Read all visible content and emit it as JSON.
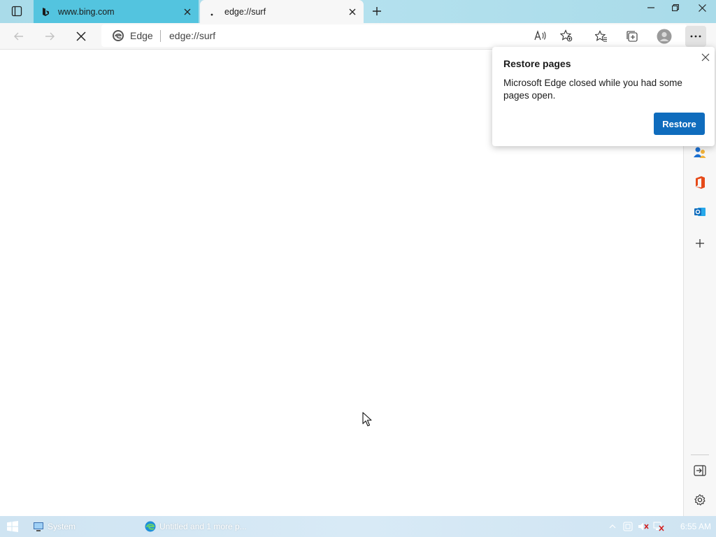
{
  "window": {
    "controls": {
      "minimize_icon": "minimize-icon",
      "restore_icon": "restore-icon",
      "close_icon": "close-icon"
    }
  },
  "tabs": [
    {
      "title": "www.bing.com",
      "icon": "bing-favicon",
      "active": false
    },
    {
      "title": "edge://surf",
      "icon": "loading-dot",
      "active": true
    }
  ],
  "toolbar": {
    "site_label": "Edge",
    "url": "edge://surf",
    "buttons": [
      "back",
      "forward",
      "stop",
      "read-aloud",
      "add-favorite",
      "favorites",
      "collections",
      "profile",
      "more"
    ]
  },
  "sidebar": {
    "items": [
      "people-icon",
      "office-icon",
      "outlook-icon",
      "add-icon"
    ],
    "bottom": [
      "hide-sidebar-icon",
      "settings-icon"
    ]
  },
  "popup": {
    "title": "Restore pages",
    "message": "Microsoft Edge closed while you had some pages open.",
    "button": "Restore"
  },
  "taskbar": {
    "items": [
      {
        "label": "System",
        "icon": "system-icon"
      },
      {
        "label": "Untitled and 1 more p...",
        "icon": "edge-icon"
      }
    ],
    "clock": "6:55 AM"
  },
  "colors": {
    "tabstrip": "#a9dbe9",
    "active_tab_bing": "#53c4df",
    "toolbar": "#f7f7f7",
    "accent": "#0f6cbd",
    "taskbar": "#cfe4f2"
  }
}
